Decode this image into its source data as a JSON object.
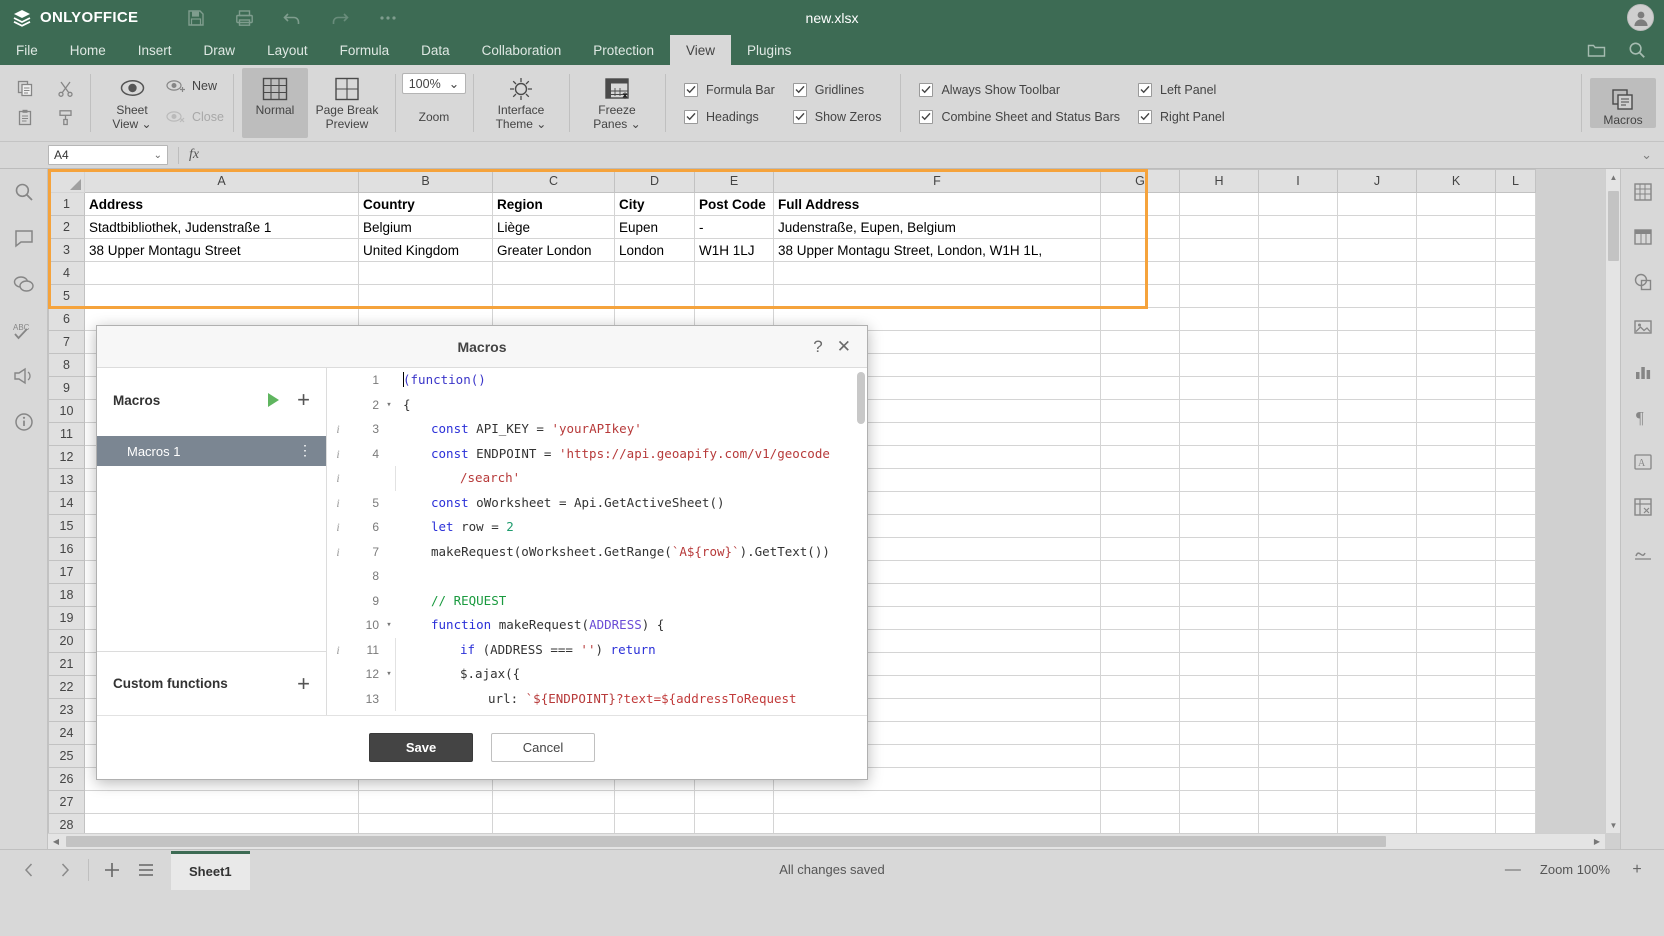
{
  "app": {
    "brand": "ONLYOFFICE",
    "document_title": "new.xlsx",
    "titlebar_icons": [
      "save-icon",
      "print-icon",
      "undo-icon",
      "redo-icon",
      "more-icon"
    ],
    "avatar_initial": "●"
  },
  "menu": {
    "items": [
      {
        "label": "File"
      },
      {
        "label": "Home"
      },
      {
        "label": "Insert"
      },
      {
        "label": "Draw"
      },
      {
        "label": "Layout"
      },
      {
        "label": "Formula"
      },
      {
        "label": "Data"
      },
      {
        "label": "Collaboration"
      },
      {
        "label": "Protection"
      },
      {
        "label": "View"
      },
      {
        "label": "Plugins"
      }
    ],
    "active": "View"
  },
  "ribbon": {
    "sheet_view": {
      "main_label_line1": "Sheet",
      "main_label_line2": "View",
      "new_label": "New",
      "close_label": "Close"
    },
    "normal_label": "Normal",
    "page_break_line1": "Page Break",
    "page_break_line2": "Preview",
    "zoom": {
      "value": "100%",
      "label": "Zoom"
    },
    "interface_theme_line1": "Interface",
    "interface_theme_line2": "Theme",
    "freeze_panes_line1": "Freeze",
    "freeze_panes_line2": "Panes",
    "checkboxes": [
      {
        "label": "Formula Bar",
        "checked": true
      },
      {
        "label": "Headings",
        "checked": true
      },
      {
        "label": "Gridlines",
        "checked": true
      },
      {
        "label": "Show Zeros",
        "checked": true
      },
      {
        "label": "Always Show Toolbar",
        "checked": true
      },
      {
        "label": "Combine Sheet and Status Bars",
        "checked": true
      },
      {
        "label": "Left Panel",
        "checked": true
      },
      {
        "label": "Right Panel",
        "checked": true
      }
    ],
    "macros_label": "Macros"
  },
  "formula_bar": {
    "name_box_value": "A4",
    "fx_label": "fx",
    "formula_value": ""
  },
  "sheet": {
    "columns": [
      "A",
      "B",
      "C",
      "D",
      "E",
      "F",
      "G",
      "H",
      "I",
      "J",
      "K",
      "L"
    ],
    "header_row": [
      "Address",
      "Country",
      "Region",
      "City",
      "Post Code",
      "Full Address"
    ],
    "rows": [
      {
        "num": "2",
        "cells": [
          "Stadtbibliothek, Judenstraße 1",
          "Belgium",
          "Liège",
          "Eupen",
          "-",
          "Judenstraße, Eupen, Belgium"
        ]
      },
      {
        "num": "3",
        "cells": [
          "38 Upper Montagu Street",
          "United Kingdom",
          "Greater London",
          "London",
          "W1H 1LJ",
          "38 Upper Montagu Street, London, W1H 1L,"
        ]
      }
    ],
    "empty_row_numbers": [
      "4",
      "5",
      "6",
      "7",
      "8",
      "9",
      "10",
      "11",
      "12",
      "13",
      "14",
      "15",
      "16",
      "17",
      "18",
      "19",
      "20",
      "21",
      "22",
      "23",
      "24",
      "25",
      "26",
      "27",
      "28"
    ],
    "selection_cell": "A4"
  },
  "macros_dialog": {
    "title": "Macros",
    "help_label": "?",
    "close_label": "✕",
    "macros_section_label": "Macros",
    "custom_functions_label": "Custom functions",
    "macro_items": [
      {
        "name": "Macros 1",
        "selected": true
      }
    ],
    "save_label": "Save",
    "cancel_label": "Cancel",
    "code_lines": [
      {
        "n": "1",
        "info": false,
        "fold": "",
        "indent": 0,
        "tokens": [
          {
            "t": "caret",
            "v": ""
          },
          {
            "t": "fn",
            "v": "(function()"
          }
        ]
      },
      {
        "n": "2",
        "info": false,
        "fold": "▾",
        "indent": 0,
        "tokens": [
          {
            "t": "plain",
            "v": "{"
          }
        ]
      },
      {
        "n": "3",
        "info": true,
        "fold": "",
        "indent": 1,
        "tokens": [
          {
            "t": "kw",
            "v": "const"
          },
          {
            "t": "plain",
            "v": " API_KEY = "
          },
          {
            "t": "str",
            "v": "'yourAPIkey'"
          }
        ]
      },
      {
        "n": "4",
        "info": true,
        "fold": "",
        "indent": 1,
        "tokens": [
          {
            "t": "kw",
            "v": "const"
          },
          {
            "t": "plain",
            "v": " ENDPOINT = "
          },
          {
            "t": "str",
            "v": "'https://api.geoapify.com/v1/geocode"
          }
        ]
      },
      {
        "n": "",
        "info": true,
        "fold": "",
        "indent": 2,
        "tokens": [
          {
            "t": "str",
            "v": "/search'"
          }
        ]
      },
      {
        "n": "5",
        "info": true,
        "fold": "",
        "indent": 1,
        "tokens": [
          {
            "t": "kw",
            "v": "const"
          },
          {
            "t": "plain",
            "v": " oWorksheet = Api.GetActiveSheet()"
          }
        ]
      },
      {
        "n": "6",
        "info": true,
        "fold": "",
        "indent": 1,
        "tokens": [
          {
            "t": "kw",
            "v": "let"
          },
          {
            "t": "plain",
            "v": " row = "
          },
          {
            "t": "num",
            "v": "2"
          }
        ]
      },
      {
        "n": "7",
        "info": true,
        "fold": "",
        "indent": 1,
        "tokens": [
          {
            "t": "plain",
            "v": "makeRequest(oWorksheet.GetRange("
          },
          {
            "t": "str",
            "v": "`A${row}`"
          },
          {
            "t": "plain",
            "v": ").GetText())"
          }
        ]
      },
      {
        "n": "8",
        "info": false,
        "fold": "",
        "indent": 1,
        "tokens": []
      },
      {
        "n": "9",
        "info": false,
        "fold": "",
        "indent": 1,
        "tokens": [
          {
            "t": "com",
            "v": "// REQUEST"
          }
        ]
      },
      {
        "n": "10",
        "info": false,
        "fold": "▾",
        "indent": 1,
        "tokens": [
          {
            "t": "kw",
            "v": "function"
          },
          {
            "t": "plain",
            "v": " makeRequest("
          },
          {
            "t": "param",
            "v": "ADDRESS"
          },
          {
            "t": "plain",
            "v": ") {"
          }
        ]
      },
      {
        "n": "11",
        "info": true,
        "fold": "",
        "indent": 2,
        "tokens": [
          {
            "t": "kw",
            "v": "if"
          },
          {
            "t": "plain",
            "v": " (ADDRESS === "
          },
          {
            "t": "str",
            "v": "''"
          },
          {
            "t": "plain",
            "v": ") "
          },
          {
            "t": "kw",
            "v": "return"
          }
        ]
      },
      {
        "n": "12",
        "info": false,
        "fold": "▾",
        "indent": 2,
        "tokens": [
          {
            "t": "plain",
            "v": "$.ajax({"
          }
        ]
      },
      {
        "n": "13",
        "info": false,
        "fold": "",
        "indent": 3,
        "tokens": [
          {
            "t": "plain",
            "v": "url: "
          },
          {
            "t": "str",
            "v": "`${ENDPOINT}"
          },
          {
            "t": "strq",
            "v": "?text=${addressToRequest"
          }
        ]
      }
    ]
  },
  "status_bar": {
    "sheet_tab": "Sheet1",
    "status_message": "All changes saved",
    "zoom_label": "Zoom 100%",
    "zoom_out": "—",
    "zoom_in": "+"
  },
  "colors": {
    "brand_green": "#3d6b54",
    "selection_orange": "#f5a33c",
    "macro_selected": "#7b8692",
    "chrome_gray": "#d8d8d8"
  }
}
